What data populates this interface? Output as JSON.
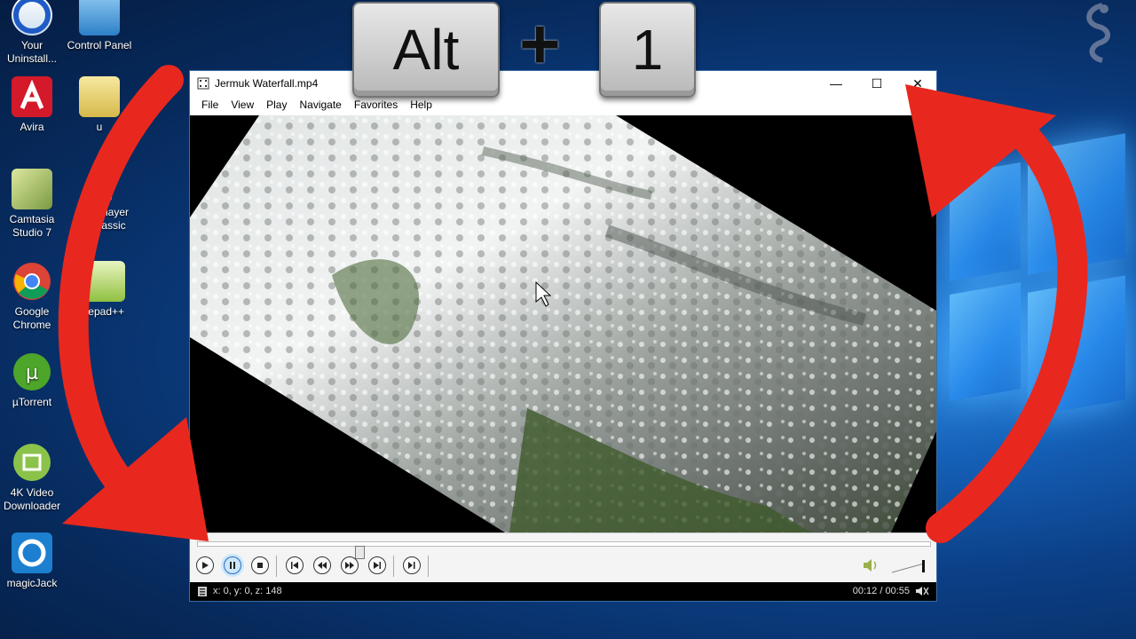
{
  "desktop": {
    "icons_left": [
      {
        "label": "Your Uninstall...",
        "icon": "uninstaller-icon"
      },
      {
        "label": "Avira",
        "icon": "avira-icon"
      },
      {
        "label": "Camtasia Studio 7",
        "icon": "camtasia-icon"
      },
      {
        "label": "Google Chrome",
        "icon": "chrome-icon"
      },
      {
        "label": "µTorrent",
        "icon": "utorrent-icon"
      },
      {
        "label": "4K Video Downloader",
        "icon": "4k-video-downloader-icon"
      },
      {
        "label": "magicJack",
        "icon": "magicjack-icon"
      }
    ],
    "icons_right": [
      {
        "label": "Control Panel",
        "icon": "control-panel-icon"
      },
      {
        "label": "u",
        "icon": "document-icon"
      },
      {
        "label": "Player\nassic",
        "icon": "media-player-classic-icon"
      },
      {
        "label": "tepad++",
        "icon": "notepad-plus-plus-icon"
      }
    ]
  },
  "overlay": {
    "key1": "Alt",
    "plus": "+",
    "key2": "1",
    "arrow_color": "#e8281e"
  },
  "window": {
    "title": "Jermuk Waterfall.mp4",
    "menu": [
      "File",
      "View",
      "Play",
      "Navigate",
      "Favorites",
      "Help"
    ],
    "controls": {
      "minimize": "—",
      "maximize": "☐",
      "close": "✕"
    },
    "status_left": "x: 0, y: 0, z: 148",
    "status_time": "00:12 / 00:55",
    "playback": {
      "progress": 0.22,
      "volume": 1.0
    }
  }
}
